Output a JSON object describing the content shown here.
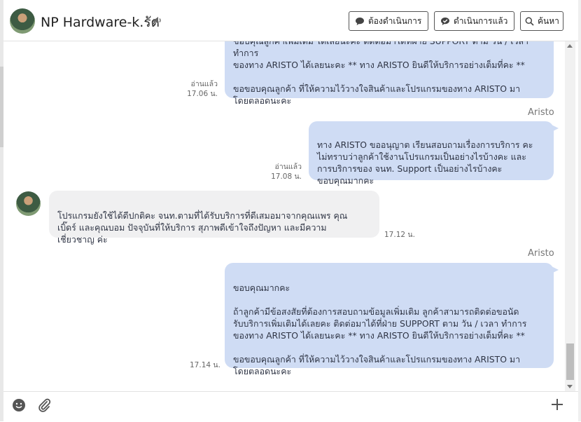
{
  "header": {
    "title": "NP Hardware-k.รัต",
    "buttons": {
      "pending": "ต้องดำเนินการ",
      "done": "ดำเนินการแล้ว",
      "search": "ค้นหา"
    }
  },
  "messages": [
    {
      "text": "ขอบคุณลูกค้าเพิ่มเติม ได้เลยนะคะ ติดต่อมาได้ที่ฝ่าย SUPPORT ตาม วัน / เวลา ทำการ\nของทาง ARISTO ได้เลยนะคะ ** ทาง ARISTO ยินดีให้บริการอย่างเต็มที่คะ **\n\nขอขอบคุณลูกค้า ที่ให้ความไว้วางใจสินค้าและโปรแกรมของทาง ARISTO มา\nโดยตลอดนะคะ",
      "read": "อ่านแล้ว",
      "time": "17.06 น."
    },
    {
      "sender": "Aristo",
      "text": "ทาง ARISTO ขออนุญาต เรียนสอบถามเรื่องการบริการ คะ\nไม่ทราบว่าลูกค้าใช้งานโปรแกรมเป็นอย่างไรบ้างคะ และ\nการบริการของ จนท. Support เป็นอย่างไรบ้างคะ\nขอบคุณมากคะ",
      "read": "อ่านแล้ว",
      "time": "17.08 น."
    },
    {
      "text": "โปรแกรมยังใช้ได้ดีปกติคะ จนท.ตามที่ได้รับบริการที่ดีเสมอมาจากคุณแพร คุณ\nเบิ๊ดร์ และคุณบอม ปัจจุบันที่ให้บริการ สุภาพดีเข้าใจถึงปัญหา และมีความ\nเชี่ยวชาญ ค่ะ",
      "time": "17.12 น."
    },
    {
      "sender": "Aristo",
      "text": "ขอบคุณมากคะ\n\nถ้าลูกค้ามีข้อสงสัยที่ต้องการสอบถามข้อมูลเพิ่มเติม ลูกค้าสามารถติดต่อขอนัด\nรับบริการเพิ่มเติมได้เลยคะ ติดต่อมาได้ที่ฝ่าย SUPPORT ตาม วัน / เวลา ทำการ\nของทาง ARISTO ได้เลยนะคะ ** ทาง ARISTO ยินดีให้บริการอย่างเต็มที่คะ **\n\nขอขอบคุณลูกค้า ที่ให้ความไว้วางใจสินค้าและโปรแกรมของทาง ARISTO มา\nโดยตลอดนะคะ",
      "time": "17.14 น."
    }
  ],
  "icons": [
    "speaker-icon",
    "chat-bubble-icon",
    "search-icon",
    "smiley-icon",
    "paperclip-icon",
    "plus-icon"
  ],
  "colors": {
    "outgoing_bubble": "#cfdcf4",
    "incoming_bubble": "#f0f0f1"
  }
}
